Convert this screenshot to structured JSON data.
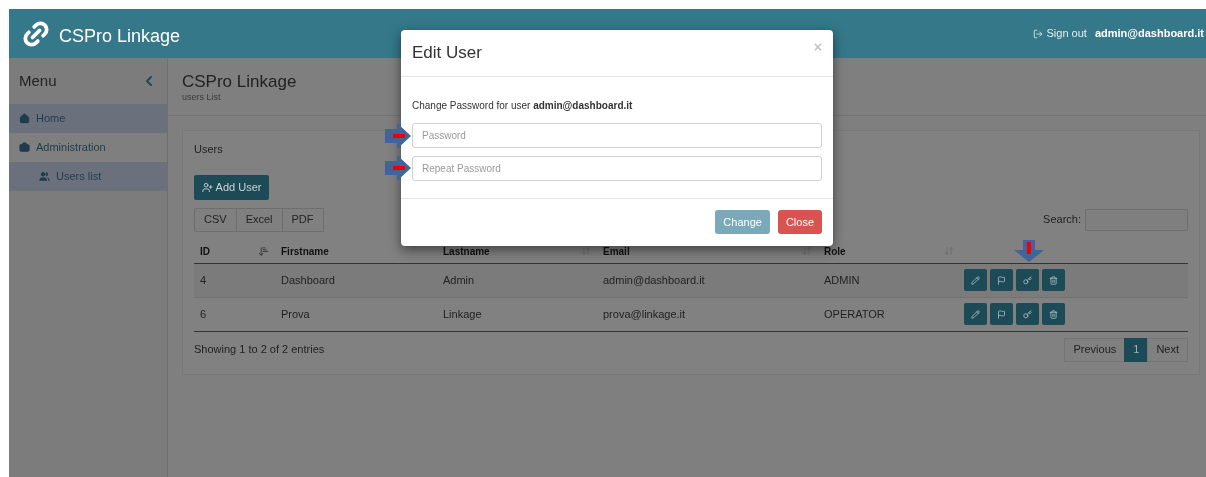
{
  "navbar": {
    "brand": "CSPro Linkage",
    "sign_out": "Sign out",
    "user": "admin@dashboard.it"
  },
  "sidebar": {
    "title": "Menu",
    "items": [
      {
        "label": "Home",
        "selected": true
      },
      {
        "label": "Administration",
        "selected": false,
        "children": [
          {
            "label": "Users list",
            "selected": true
          }
        ]
      }
    ]
  },
  "page": {
    "title": "CSPro Linkage",
    "subtitle": "users List"
  },
  "panel": {
    "title": "Users",
    "add_button": "Add User",
    "export_buttons": [
      "CSV",
      "Excel",
      "PDF"
    ],
    "search_label": "Search:",
    "table": {
      "columns": [
        {
          "label": "ID",
          "kind": "sorted"
        },
        {
          "label": "Firstname",
          "kind": "plain"
        },
        {
          "label": "Lastname",
          "kind": "sortable"
        },
        {
          "label": "Email",
          "kind": "sortable"
        },
        {
          "label": "Role",
          "kind": "sortable"
        }
      ],
      "rows": [
        {
          "cells": [
            "4",
            "Dashboard",
            "Admin",
            "admin@dashboard.it",
            "ADMIN"
          ]
        },
        {
          "cells": [
            "6",
            "Prova",
            "Linkage",
            "prova@linkage.it",
            "OPERATOR"
          ]
        }
      ]
    },
    "info": "Showing 1 to 2 of 2 entries",
    "pagination": [
      {
        "label": "Previous",
        "selected": false
      },
      {
        "label": "1",
        "selected": true
      },
      {
        "label": "Next",
        "selected": false
      }
    ]
  },
  "modal": {
    "title": "Edit User",
    "close": "×",
    "message": "Change Password for user **admin@dashboard.it**",
    "fields": [
      {
        "placeholder": "Password"
      },
      {
        "placeholder": "Repeat Password"
      }
    ],
    "buttons": [
      {
        "label": "Change",
        "kind": "primary"
      },
      {
        "label": "Close",
        "kind": "danger"
      }
    ]
  }
}
